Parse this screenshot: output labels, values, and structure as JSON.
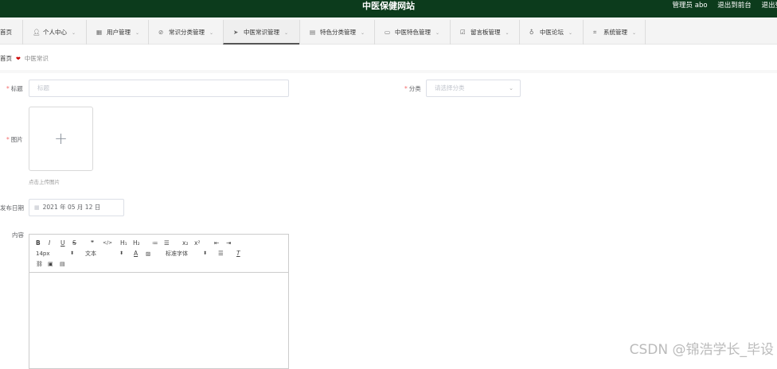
{
  "header": {
    "site_title": "中医保健网站",
    "user_label": "管理员 abo",
    "back_front": "退出到前台",
    "logout": "退出登"
  },
  "nav": {
    "home": "首页",
    "items": [
      {
        "label": "个人中心",
        "icon": "user-icon"
      },
      {
        "label": "用户管理",
        "icon": "grid-icon"
      },
      {
        "label": "常识分类管理",
        "icon": "book-icon"
      },
      {
        "label": "中医常识管理",
        "icon": "send-icon"
      },
      {
        "label": "特色分类管理",
        "icon": "list-icon"
      },
      {
        "label": "中医特色管理",
        "icon": "message-icon"
      },
      {
        "label": "留言板管理",
        "icon": "checkbox-icon"
      },
      {
        "label": "中医论坛",
        "icon": "bulb-icon"
      },
      {
        "label": "系统管理",
        "icon": "crop-icon"
      }
    ],
    "active_index": 3
  },
  "breadcrumb": {
    "home": "首页",
    "current": "中医常识"
  },
  "form": {
    "title_label": "标题",
    "title_placeholder": "标题",
    "category_label": "分类",
    "category_placeholder": "请选择分类",
    "image_label": "图片",
    "upload_hint": "点击上传图片",
    "date_label": "发布日期",
    "date_value": "2021 年 05 月 12 日",
    "content_label": "内容"
  },
  "editor": {
    "font_size": "14px",
    "text_type": "文本",
    "font_family": "标准字体",
    "buttons_row1": [
      "B",
      "I",
      "U",
      "S",
      "❞",
      "</>",
      "H₁",
      "H₂",
      "≔",
      "☰",
      "x₂",
      "x²",
      "⇤",
      "⇥"
    ]
  },
  "watermark": "CSDN @锦浩学长_毕设"
}
